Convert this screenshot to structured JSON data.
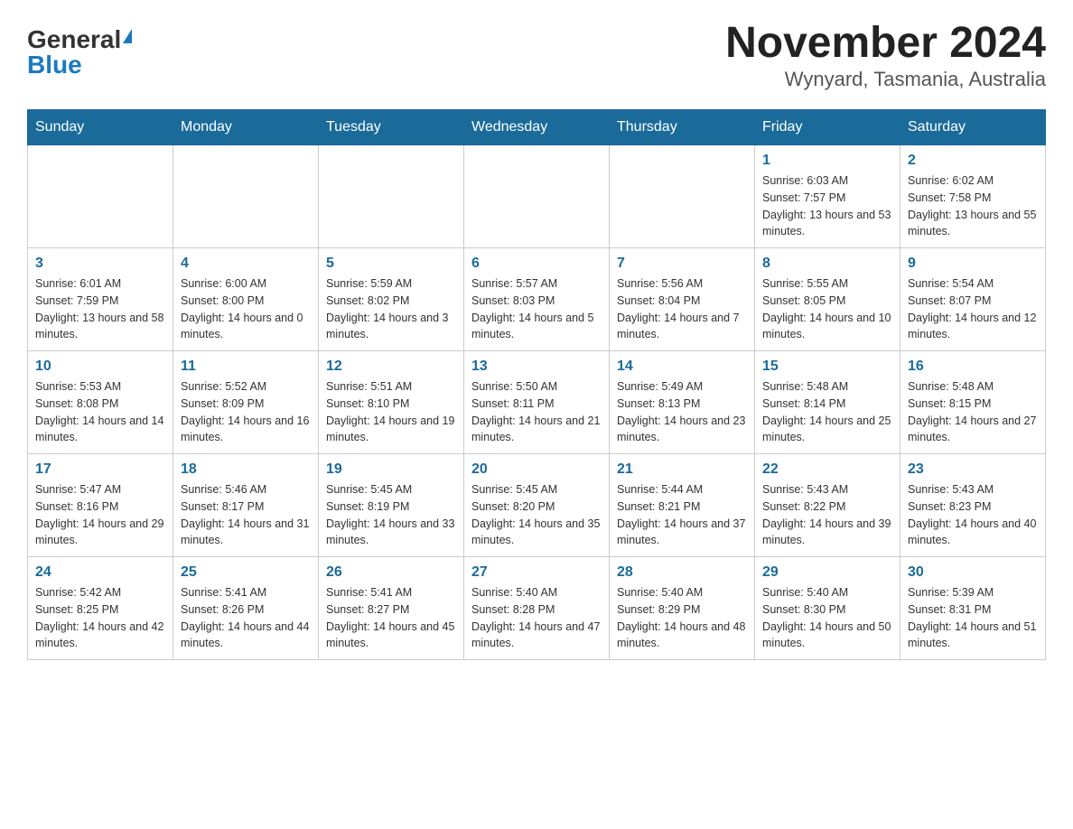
{
  "header": {
    "logo_general": "General",
    "logo_blue": "Blue",
    "month_year": "November 2024",
    "location": "Wynyard, Tasmania, Australia"
  },
  "weekdays": [
    "Sunday",
    "Monday",
    "Tuesday",
    "Wednesday",
    "Thursday",
    "Friday",
    "Saturday"
  ],
  "weeks": [
    [
      {
        "day": "",
        "sunrise": "",
        "sunset": "",
        "daylight": ""
      },
      {
        "day": "",
        "sunrise": "",
        "sunset": "",
        "daylight": ""
      },
      {
        "day": "",
        "sunrise": "",
        "sunset": "",
        "daylight": ""
      },
      {
        "day": "",
        "sunrise": "",
        "sunset": "",
        "daylight": ""
      },
      {
        "day": "",
        "sunrise": "",
        "sunset": "",
        "daylight": ""
      },
      {
        "day": "1",
        "sunrise": "Sunrise: 6:03 AM",
        "sunset": "Sunset: 7:57 PM",
        "daylight": "Daylight: 13 hours and 53 minutes."
      },
      {
        "day": "2",
        "sunrise": "Sunrise: 6:02 AM",
        "sunset": "Sunset: 7:58 PM",
        "daylight": "Daylight: 13 hours and 55 minutes."
      }
    ],
    [
      {
        "day": "3",
        "sunrise": "Sunrise: 6:01 AM",
        "sunset": "Sunset: 7:59 PM",
        "daylight": "Daylight: 13 hours and 58 minutes."
      },
      {
        "day": "4",
        "sunrise": "Sunrise: 6:00 AM",
        "sunset": "Sunset: 8:00 PM",
        "daylight": "Daylight: 14 hours and 0 minutes."
      },
      {
        "day": "5",
        "sunrise": "Sunrise: 5:59 AM",
        "sunset": "Sunset: 8:02 PM",
        "daylight": "Daylight: 14 hours and 3 minutes."
      },
      {
        "day": "6",
        "sunrise": "Sunrise: 5:57 AM",
        "sunset": "Sunset: 8:03 PM",
        "daylight": "Daylight: 14 hours and 5 minutes."
      },
      {
        "day": "7",
        "sunrise": "Sunrise: 5:56 AM",
        "sunset": "Sunset: 8:04 PM",
        "daylight": "Daylight: 14 hours and 7 minutes."
      },
      {
        "day": "8",
        "sunrise": "Sunrise: 5:55 AM",
        "sunset": "Sunset: 8:05 PM",
        "daylight": "Daylight: 14 hours and 10 minutes."
      },
      {
        "day": "9",
        "sunrise": "Sunrise: 5:54 AM",
        "sunset": "Sunset: 8:07 PM",
        "daylight": "Daylight: 14 hours and 12 minutes."
      }
    ],
    [
      {
        "day": "10",
        "sunrise": "Sunrise: 5:53 AM",
        "sunset": "Sunset: 8:08 PM",
        "daylight": "Daylight: 14 hours and 14 minutes."
      },
      {
        "day": "11",
        "sunrise": "Sunrise: 5:52 AM",
        "sunset": "Sunset: 8:09 PM",
        "daylight": "Daylight: 14 hours and 16 minutes."
      },
      {
        "day": "12",
        "sunrise": "Sunrise: 5:51 AM",
        "sunset": "Sunset: 8:10 PM",
        "daylight": "Daylight: 14 hours and 19 minutes."
      },
      {
        "day": "13",
        "sunrise": "Sunrise: 5:50 AM",
        "sunset": "Sunset: 8:11 PM",
        "daylight": "Daylight: 14 hours and 21 minutes."
      },
      {
        "day": "14",
        "sunrise": "Sunrise: 5:49 AM",
        "sunset": "Sunset: 8:13 PM",
        "daylight": "Daylight: 14 hours and 23 minutes."
      },
      {
        "day": "15",
        "sunrise": "Sunrise: 5:48 AM",
        "sunset": "Sunset: 8:14 PM",
        "daylight": "Daylight: 14 hours and 25 minutes."
      },
      {
        "day": "16",
        "sunrise": "Sunrise: 5:48 AM",
        "sunset": "Sunset: 8:15 PM",
        "daylight": "Daylight: 14 hours and 27 minutes."
      }
    ],
    [
      {
        "day": "17",
        "sunrise": "Sunrise: 5:47 AM",
        "sunset": "Sunset: 8:16 PM",
        "daylight": "Daylight: 14 hours and 29 minutes."
      },
      {
        "day": "18",
        "sunrise": "Sunrise: 5:46 AM",
        "sunset": "Sunset: 8:17 PM",
        "daylight": "Daylight: 14 hours and 31 minutes."
      },
      {
        "day": "19",
        "sunrise": "Sunrise: 5:45 AM",
        "sunset": "Sunset: 8:19 PM",
        "daylight": "Daylight: 14 hours and 33 minutes."
      },
      {
        "day": "20",
        "sunrise": "Sunrise: 5:45 AM",
        "sunset": "Sunset: 8:20 PM",
        "daylight": "Daylight: 14 hours and 35 minutes."
      },
      {
        "day": "21",
        "sunrise": "Sunrise: 5:44 AM",
        "sunset": "Sunset: 8:21 PM",
        "daylight": "Daylight: 14 hours and 37 minutes."
      },
      {
        "day": "22",
        "sunrise": "Sunrise: 5:43 AM",
        "sunset": "Sunset: 8:22 PM",
        "daylight": "Daylight: 14 hours and 39 minutes."
      },
      {
        "day": "23",
        "sunrise": "Sunrise: 5:43 AM",
        "sunset": "Sunset: 8:23 PM",
        "daylight": "Daylight: 14 hours and 40 minutes."
      }
    ],
    [
      {
        "day": "24",
        "sunrise": "Sunrise: 5:42 AM",
        "sunset": "Sunset: 8:25 PM",
        "daylight": "Daylight: 14 hours and 42 minutes."
      },
      {
        "day": "25",
        "sunrise": "Sunrise: 5:41 AM",
        "sunset": "Sunset: 8:26 PM",
        "daylight": "Daylight: 14 hours and 44 minutes."
      },
      {
        "day": "26",
        "sunrise": "Sunrise: 5:41 AM",
        "sunset": "Sunset: 8:27 PM",
        "daylight": "Daylight: 14 hours and 45 minutes."
      },
      {
        "day": "27",
        "sunrise": "Sunrise: 5:40 AM",
        "sunset": "Sunset: 8:28 PM",
        "daylight": "Daylight: 14 hours and 47 minutes."
      },
      {
        "day": "28",
        "sunrise": "Sunrise: 5:40 AM",
        "sunset": "Sunset: 8:29 PM",
        "daylight": "Daylight: 14 hours and 48 minutes."
      },
      {
        "day": "29",
        "sunrise": "Sunrise: 5:40 AM",
        "sunset": "Sunset: 8:30 PM",
        "daylight": "Daylight: 14 hours and 50 minutes."
      },
      {
        "day": "30",
        "sunrise": "Sunrise: 5:39 AM",
        "sunset": "Sunset: 8:31 PM",
        "daylight": "Daylight: 14 hours and 51 minutes."
      }
    ]
  ]
}
